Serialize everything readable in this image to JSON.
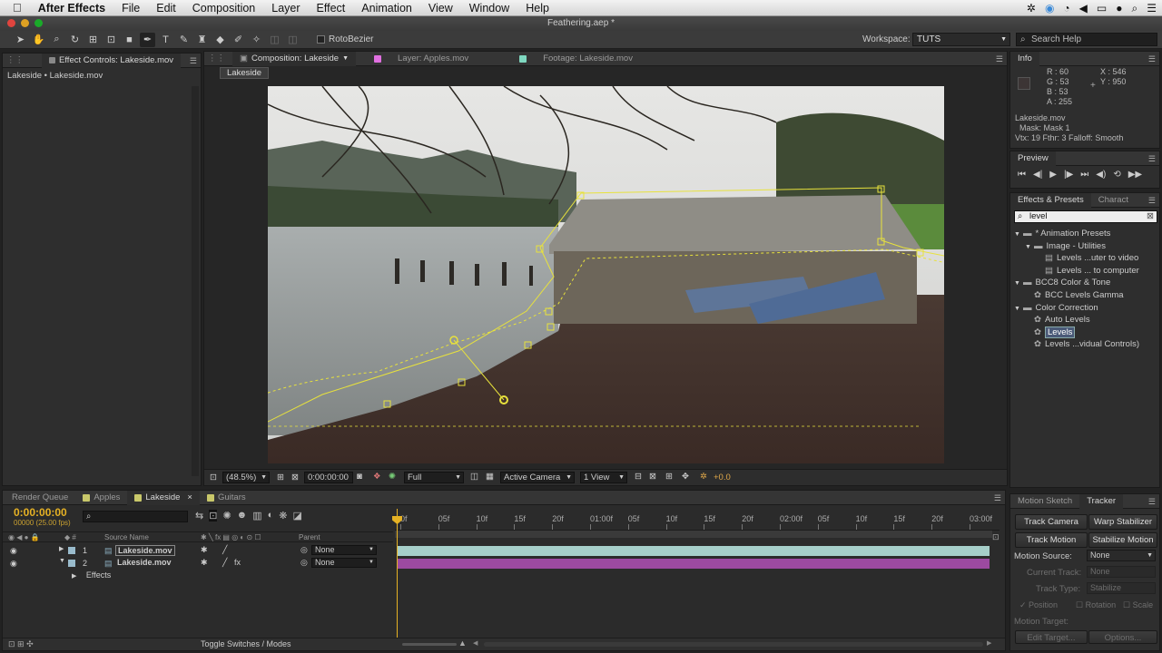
{
  "menubar": {
    "app": "After Effects",
    "items": [
      "File",
      "Edit",
      "Composition",
      "Layer",
      "Effect",
      "Animation",
      "View",
      "Window",
      "Help"
    ]
  },
  "window": {
    "title": "Feathering.aep *"
  },
  "toolbar": {
    "rotobezier_label": "RotoBezier",
    "workspace_label": "Workspace:",
    "workspace_value": "TUTS",
    "search_placeholder": "Search Help"
  },
  "effect_controls": {
    "tab": "Effect Controls: Lakeside.mov",
    "breadcrumb": "Lakeside • Lakeside.mov"
  },
  "composition": {
    "tabs": [
      {
        "label": "Composition: Lakeside",
        "color": "#e070e0"
      },
      {
        "label": "Layer: Apples.mov",
        "color": "#e070e0"
      },
      {
        "label": "Footage: Lakeside.mov",
        "color": "#7fd8c0"
      }
    ],
    "flow_label": "Lakeside",
    "footer": {
      "zoom": "(48.5%)",
      "timecode": "0:00:00:00",
      "resolution": "Full",
      "camera": "Active Camera",
      "views": "1 View",
      "exposure": "+0.0"
    }
  },
  "info": {
    "tab": "Info",
    "r": "R : 60",
    "g": "G : 53",
    "b": "B : 53",
    "a": "A : 255",
    "x": "X : 546",
    "y": "Y : 950",
    "layer": "Lakeside.mov",
    "mask": "Mask: Mask 1",
    "vtx": "Vtx: 19 Fthr: 3 Falloff: Smooth",
    "swatch": "#3c3535"
  },
  "preview": {
    "tab": "Preview"
  },
  "effects_presets": {
    "tabs": [
      "Effects & Presets",
      "Charact"
    ],
    "search_value": "level",
    "tree": [
      {
        "indent": 0,
        "label": "* Animation Presets",
        "type": "folder"
      },
      {
        "indent": 1,
        "label": "Image - Utilities",
        "type": "folder"
      },
      {
        "indent": 2,
        "label": "Levels ...uter to video",
        "type": "preset"
      },
      {
        "indent": 2,
        "label": "Levels ... to computer",
        "type": "preset"
      },
      {
        "indent": 0,
        "label": "BCC8 Color & Tone",
        "type": "folder"
      },
      {
        "indent": 1,
        "label": "BCC Levels Gamma",
        "type": "effect"
      },
      {
        "indent": 0,
        "label": "Color Correction",
        "type": "folder"
      },
      {
        "indent": 1,
        "label": "Auto Levels",
        "type": "effect"
      },
      {
        "indent": 1,
        "label": "Levels",
        "type": "effect",
        "selected": true
      },
      {
        "indent": 1,
        "label": "Levels ...vidual Controls)",
        "type": "effect"
      }
    ]
  },
  "timeline": {
    "tabs": [
      {
        "label": "Render Queue",
        "color": ""
      },
      {
        "label": "Apples",
        "color": "#c9c86a"
      },
      {
        "label": "Lakeside",
        "color": "#c9c86a"
      },
      {
        "label": "Guitars",
        "color": "#c9c86a"
      }
    ],
    "timecode": "0:00:00:00",
    "fps": "00000 (25.00 fps)",
    "col_source": "Source Name",
    "col_parent": "Parent",
    "ticks": [
      "0f",
      "05f",
      "10f",
      "15f",
      "20f",
      "01:00f",
      "05f",
      "10f",
      "15f",
      "20f",
      "02:00f",
      "05f",
      "10f",
      "15f",
      "20f",
      "03:00f"
    ],
    "layers": [
      {
        "num": "1",
        "name": "Lakeside.mov",
        "parent": "None",
        "bar_color": "#a6cfc9"
      },
      {
        "num": "2",
        "name": "Lakeside.mov",
        "parent": "None",
        "bar_color": "#9c4aa0"
      }
    ],
    "effects_label": "Effects",
    "toggle_label": "Toggle Switches / Modes"
  },
  "tracker": {
    "tabs": [
      "Motion Sketch",
      "Tracker"
    ],
    "track_camera": "Track Camera",
    "warp_stabilizer": "Warp Stabilizer",
    "track_motion": "Track Motion",
    "stabilize_motion": "Stabilize Motion",
    "motion_source_label": "Motion Source:",
    "motion_source_value": "None",
    "current_track_label": "Current Track:",
    "current_track_value": "None",
    "track_type_label": "Track Type:",
    "track_type_value": "Stabilize",
    "position": "Position",
    "rotation": "Rotation",
    "scale": "Scale",
    "motion_target": "Motion Target:",
    "edit_target": "Edit Target...",
    "options": "Options..."
  }
}
